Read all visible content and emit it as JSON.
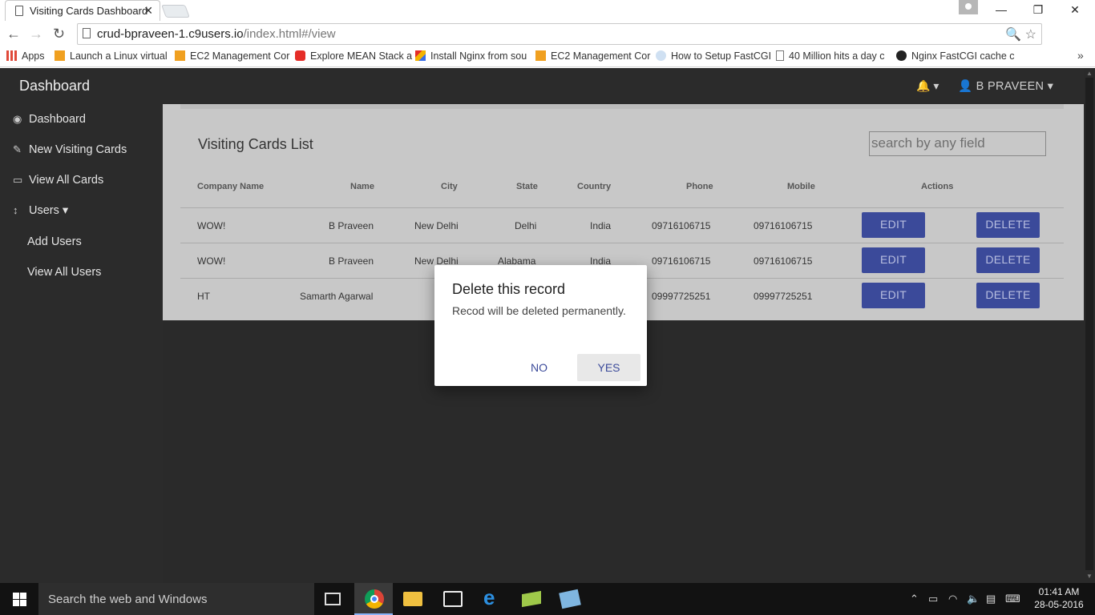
{
  "browser": {
    "tab_title": "Visiting Cards Dashboard",
    "tab_close": "✕",
    "url_host": "crud-bpraveen-1.c9users.io",
    "url_path": "/index.html#/view",
    "bookmarks": [
      {
        "label": "Apps",
        "icon": "apps-grid-icon",
        "color": "#e04a3a"
      },
      {
        "label": "Launch a Linux virtual",
        "icon": "aws-cube-icon",
        "color": "#f0a020"
      },
      {
        "label": "EC2 Management Cor",
        "icon": "aws-cube-icon",
        "color": "#f0a020"
      },
      {
        "label": "Explore MEAN Stack a",
        "icon": "youtube-icon",
        "color": "#e52d27"
      },
      {
        "label": "Install Nginx from sou",
        "icon": "colorful-logo-icon",
        "color": "#3a6ee8"
      },
      {
        "label": "EC2 Management Cor",
        "icon": "aws-cube-icon",
        "color": "#f0a020"
      },
      {
        "label": "How to Setup FastCGI",
        "icon": "cloud-icon",
        "color": "#7aa7d6"
      },
      {
        "label": "40 Million hits a day c",
        "icon": "page-icon",
        "color": "#777777"
      },
      {
        "label": "Nginx FastCGI cache c",
        "icon": "github-icon",
        "color": "#222222"
      }
    ],
    "bookmarks_more": "»"
  },
  "app": {
    "brand": "Dashboard",
    "sidebar": [
      {
        "label": "Dashboard",
        "icon": "tachometer-icon",
        "glyph": "◉"
      },
      {
        "label": "New Visiting Cards",
        "icon": "edit-icon",
        "glyph": "✎"
      },
      {
        "label": "View All Cards",
        "icon": "desktop-icon",
        "glyph": "▭"
      },
      {
        "label": "Users ▾",
        "icon": "arrows-vertical-icon",
        "glyph": "↕"
      },
      {
        "label": "Add Users",
        "icon": "",
        "glyph": ""
      },
      {
        "label": "View All Users",
        "icon": "",
        "glyph": ""
      }
    ],
    "navbar": {
      "bell": "🔔 ▾",
      "user": "👤 B PRAVEEN ▾"
    },
    "page_title": "Visiting Cards List",
    "search_placeholder": "search by any field",
    "columns": [
      "Company Name",
      "Name",
      "City",
      "State",
      "Country",
      "Phone",
      "Mobile",
      "Actions"
    ],
    "rows": [
      {
        "company": "WOW!",
        "name": "B Praveen",
        "city": "New Delhi",
        "state": "Delhi",
        "country": "India",
        "phone": "09716106715",
        "mobile": "09716106715"
      },
      {
        "company": "WOW!",
        "name": "B Praveen",
        "city": "New Delhi",
        "state": "Alabama",
        "country": "India",
        "phone": "09716106715",
        "mobile": "09716106715"
      },
      {
        "company": "HT",
        "name": "Samarth Agarwal",
        "city": "",
        "state": "",
        "country": "",
        "phone": "09997725251",
        "mobile": "09997725251"
      }
    ],
    "edit_label": "EDIT",
    "delete_label": "DELETE"
  },
  "dialog": {
    "title": "Delete this record",
    "text": "Recod will be deleted permanently.",
    "no_label": "NO",
    "yes_label": "YES"
  },
  "taskbar": {
    "search_placeholder": "Search the web and Windows",
    "time": "01:41 AM",
    "date": "28-05-2016"
  },
  "colors": {
    "accent_button": "#3b4a9a",
    "sidebar_bg": "#2b2b2b",
    "content_bg": "#c8c8c8"
  }
}
